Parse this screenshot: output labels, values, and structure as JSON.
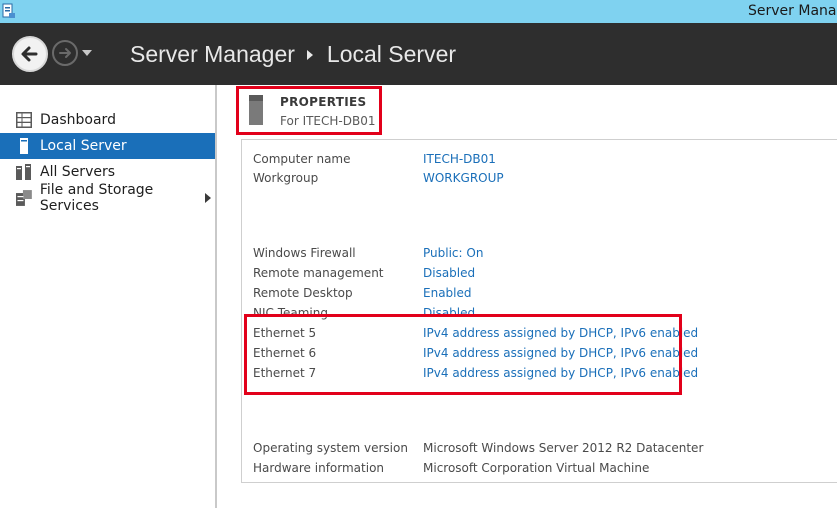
{
  "window": {
    "title": "Server Manag"
  },
  "header": {
    "breadcrumb": [
      "Server Manager",
      "Local Server"
    ]
  },
  "sidebar": {
    "items": [
      {
        "label": "Dashboard",
        "icon": "dashboard-icon"
      },
      {
        "label": "Local Server",
        "icon": "server-icon",
        "active": true
      },
      {
        "label": "All Servers",
        "icon": "servers-icon"
      },
      {
        "label": "File and Storage Services",
        "icon": "storage-icon",
        "has_submenu": true
      }
    ]
  },
  "properties": {
    "title": "PROPERTIES",
    "subtitle": "For ITECH-DB01",
    "rows": [
      {
        "label": "Computer name",
        "value": "ITECH-DB01"
      },
      {
        "label": "Workgroup",
        "value": "WORKGROUP"
      },
      {
        "label": "Windows Firewall",
        "value": "Public: On"
      },
      {
        "label": "Remote management",
        "value": "Disabled"
      },
      {
        "label": "Remote Desktop",
        "value": "Enabled"
      },
      {
        "label": "NIC Teaming",
        "value": "Disabled"
      },
      {
        "label": "Ethernet 5",
        "value": "IPv4 address assigned by DHCP, IPv6 enabled"
      },
      {
        "label": "Ethernet 6",
        "value": "IPv4 address assigned by DHCP, IPv6 enabled"
      },
      {
        "label": "Ethernet 7",
        "value": "IPv4 address assigned by DHCP, IPv6 enabled"
      },
      {
        "label": "Operating system version",
        "value": "Microsoft Windows Server 2012 R2 Datacenter"
      },
      {
        "label": "Hardware information",
        "value": "Microsoft Corporation Virtual Machine"
      }
    ]
  },
  "colors": {
    "accent": "#1a6fb9",
    "header_bg": "#2e2e2e",
    "titlebar_bg": "#7fd2f0",
    "highlight": "#e2001a"
  }
}
